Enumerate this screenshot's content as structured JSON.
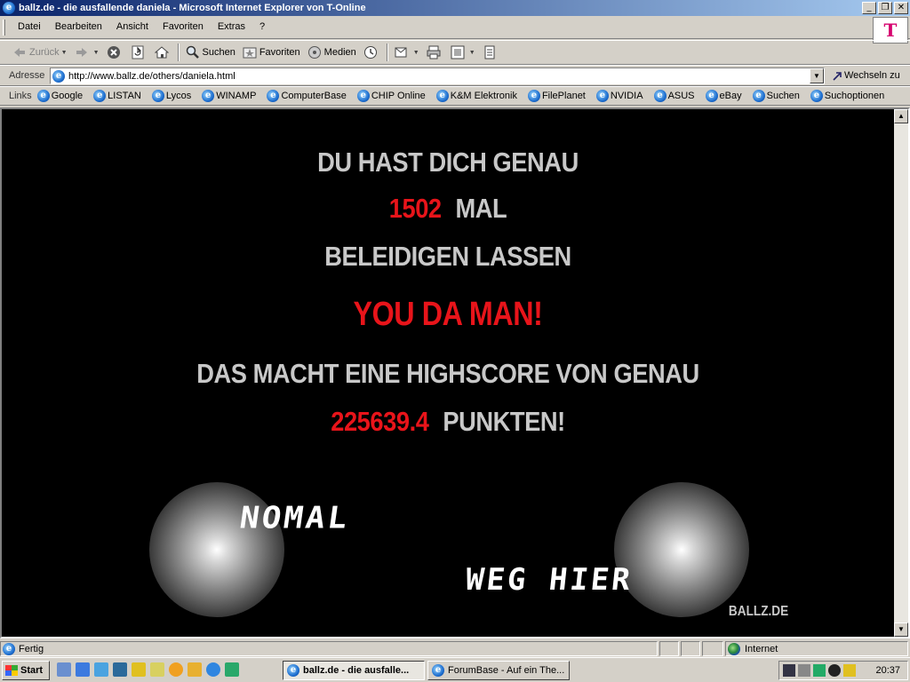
{
  "window": {
    "title": "ballz.de - die ausfallende daniela - Microsoft Internet Explorer von T-Online",
    "caption_minimize": "_",
    "caption_maximize": "❐",
    "caption_close": "✕"
  },
  "menubar": {
    "items": [
      "Datei",
      "Bearbeiten",
      "Ansicht",
      "Favoriten",
      "Extras",
      "?"
    ],
    "logo_text": "T"
  },
  "toolbar": {
    "back_label": "Zurück",
    "search_label": "Suchen",
    "favorites_label": "Favoriten",
    "media_label": "Medien"
  },
  "addressbar": {
    "label": "Adresse",
    "url": "http://www.ballz.de/others/daniela.html",
    "go_label": "Wechseln zu"
  },
  "linksbar": {
    "label": "Links",
    "items": [
      "Google",
      "LISTAN",
      "Lycos",
      "WINAMP",
      "ComputerBase",
      "CHIP Online",
      "K&M Elektronik",
      "FilePlanet",
      "NVIDIA",
      "ASUS",
      "eBay",
      "Suchen",
      "Suchoptionen"
    ]
  },
  "page": {
    "line1": "DU HAST DICH GENAU",
    "count": "1502",
    "count_suffix": "MAL",
    "line3": "BELEIDIGEN LASSEN",
    "line4": "YOU DA MAN!",
    "line5": "DAS MACHT EINE HIGHSCORE VON GENAU",
    "score": "225639.4",
    "score_suffix": "PUNKTEN!",
    "link_nomal": "NOMAL",
    "link_weg_hier": "WEG HIER",
    "logo": "BALLZ.DE",
    "colors": {
      "background": "#000000",
      "text": "#c8c8c8",
      "highlight": "#e8141a"
    }
  },
  "statusbar": {
    "status": "Fertig",
    "zone": "Internet"
  },
  "taskbar": {
    "start_label": "Start",
    "tasks": [
      "ballz.de - die ausfalle...",
      "ForumBase - Auf ein The..."
    ],
    "clock": "20:37"
  }
}
